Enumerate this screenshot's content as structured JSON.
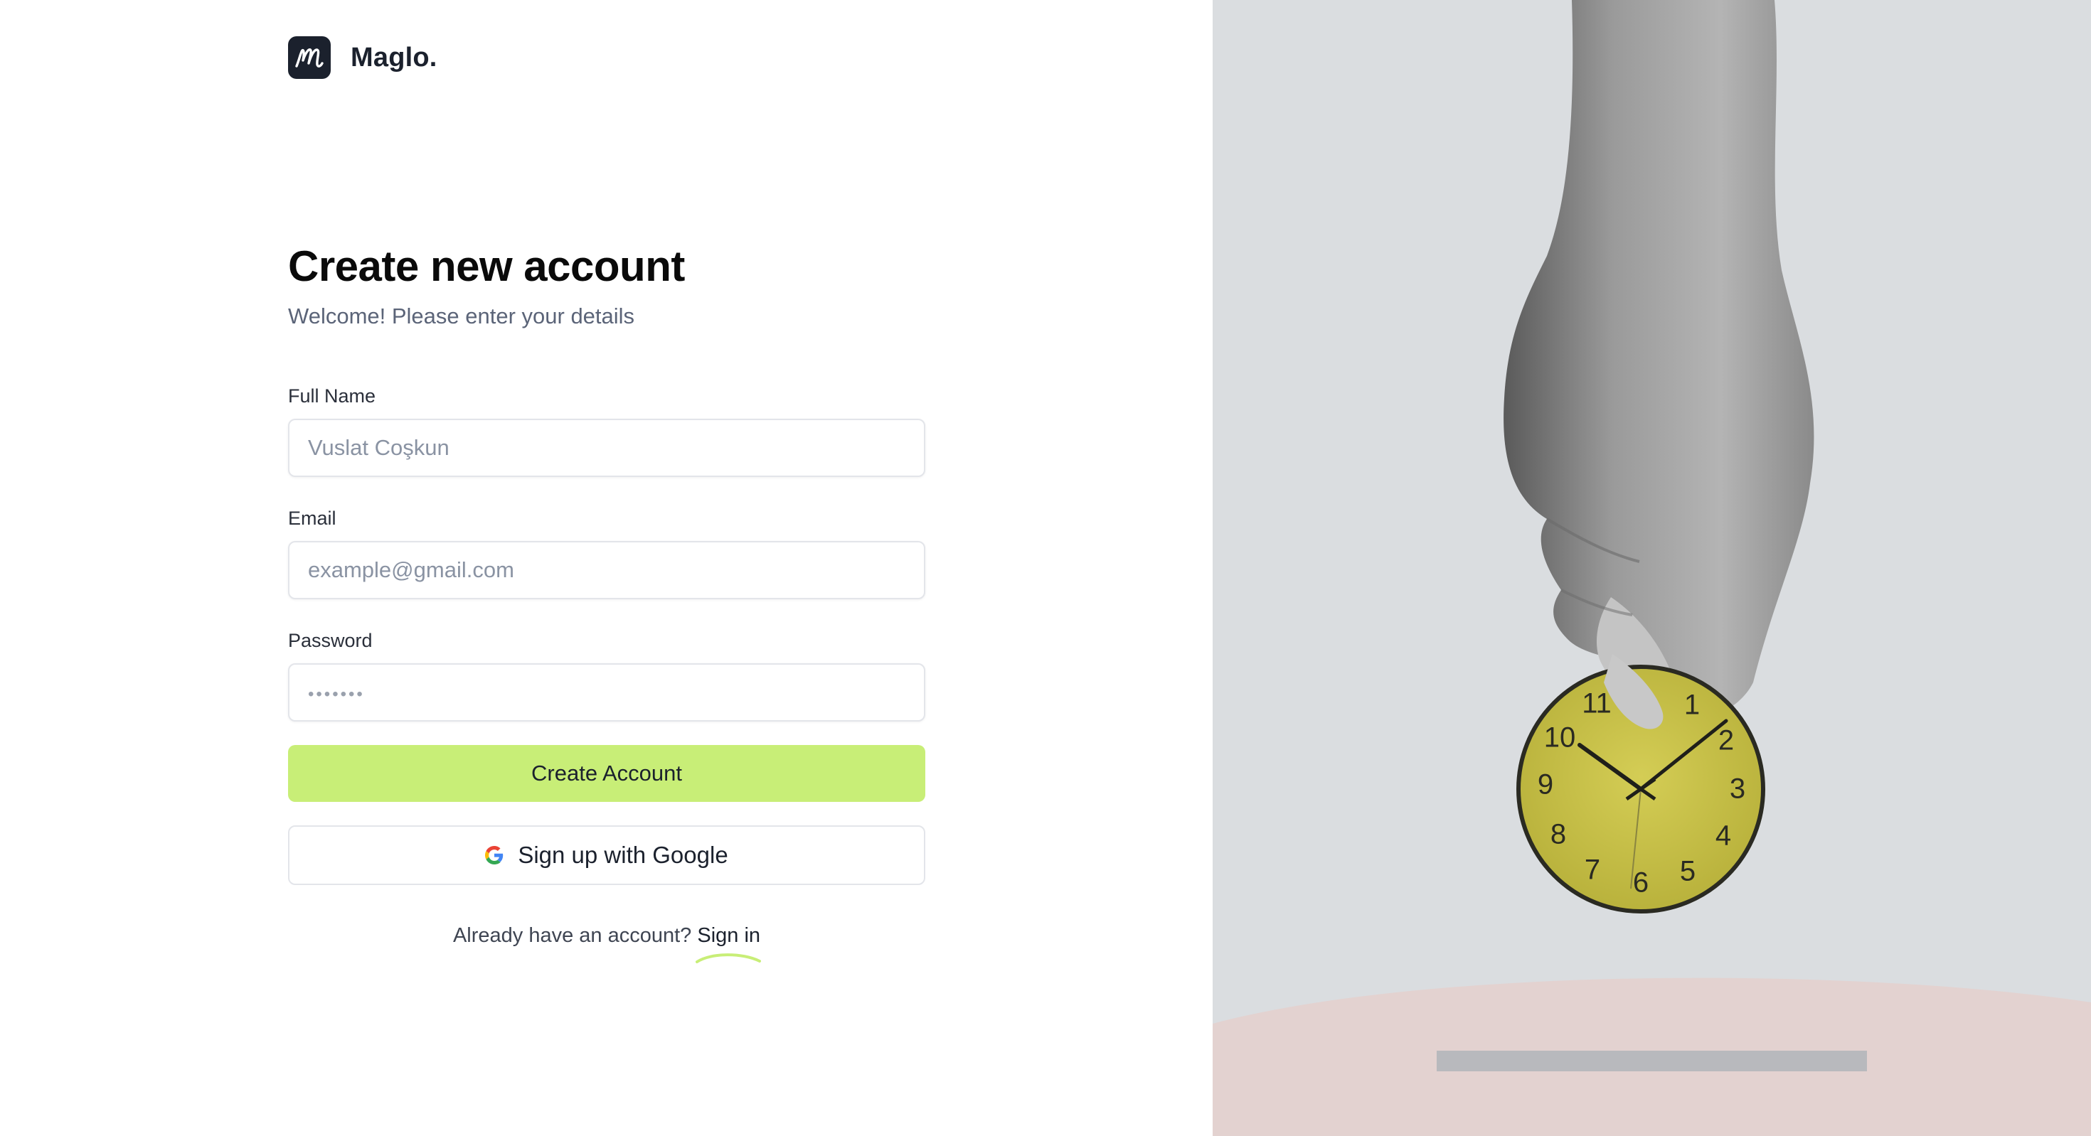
{
  "brand": {
    "name": "Maglo.",
    "logo_letter": "m",
    "colors": {
      "dark": "#1b212d",
      "accent": "#c8ee77"
    }
  },
  "header": {
    "title": "Create new account",
    "subtitle": "Welcome! Please enter your details"
  },
  "form": {
    "full_name": {
      "label": "Full Name",
      "placeholder": "Vuslat Coşkun"
    },
    "email": {
      "label": "Email",
      "placeholder": "example@gmail.com"
    },
    "password": {
      "label": "Password",
      "placeholder": "•••••••"
    },
    "submit_label": "Create Account",
    "google_label": "Sign up with Google"
  },
  "footer": {
    "prompt": "Already have an account?",
    "signin_label": "Sign in"
  },
  "illustration": {
    "clock_numbers": [
      "11",
      "1",
      "2",
      "10",
      "9",
      "3",
      "8",
      "4",
      "7",
      "6",
      "5"
    ]
  }
}
